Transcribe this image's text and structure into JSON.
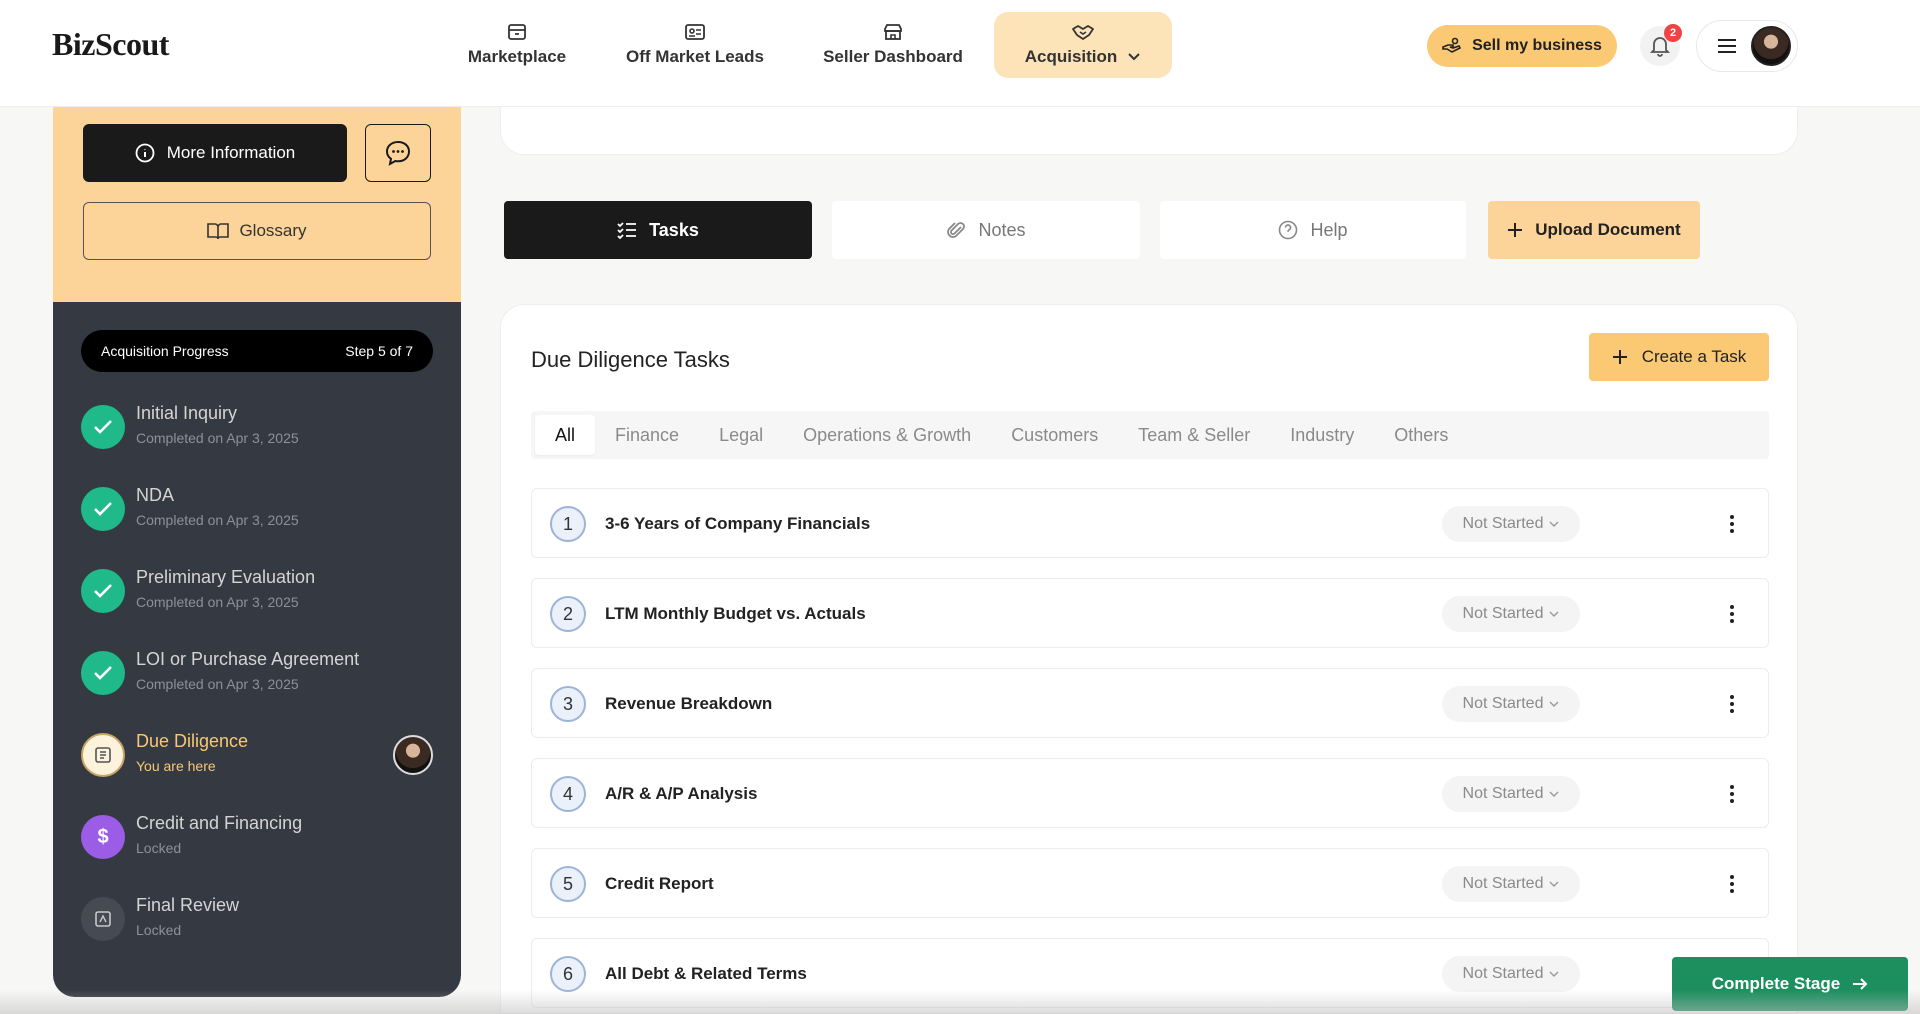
{
  "app": {
    "logo": "BizScout"
  },
  "nav": {
    "marketplace": "Marketplace",
    "off_market": "Off Market Leads",
    "seller_dashboard": "Seller Dashboard",
    "acquisition": "Acquisition"
  },
  "header": {
    "sell_label": "Sell my business",
    "notification_count": "2"
  },
  "sidebar": {
    "more_info": "More Information",
    "glossary": "Glossary",
    "progress_label": "Acquisition Progress",
    "progress_step": "Step 5 of 7",
    "steps": [
      {
        "title": "Initial Inquiry",
        "sub": "Completed on Apr 3, 2025"
      },
      {
        "title": "NDA",
        "sub": "Completed on Apr 3, 2025"
      },
      {
        "title": "Preliminary Evaluation",
        "sub": "Completed on Apr 3, 2025"
      },
      {
        "title": "LOI or Purchase Agreement",
        "sub": "Completed on Apr 3, 2025"
      },
      {
        "title": "Due Diligence",
        "sub": "You are here"
      },
      {
        "title": "Credit and Financing",
        "sub": "Locked",
        "icon_text": "$"
      },
      {
        "title": "Final Review",
        "sub": "Locked"
      }
    ]
  },
  "tabs": {
    "tasks": "Tasks",
    "notes": "Notes",
    "help": "Help",
    "upload": "Upload Document"
  },
  "tasks_card": {
    "title": "Due Diligence Tasks",
    "create": "Create a Task",
    "filters": [
      "All",
      "Finance",
      "Legal",
      "Operations & Growth",
      "Customers",
      "Team & Seller",
      "Industry",
      "Others"
    ],
    "items": [
      {
        "num": "1",
        "name": "3-6 Years of Company Financials",
        "status": "Not Started"
      },
      {
        "num": "2",
        "name": "LTM Monthly Budget vs. Actuals",
        "status": "Not Started"
      },
      {
        "num": "3",
        "name": "Revenue Breakdown",
        "status": "Not Started"
      },
      {
        "num": "4",
        "name": "A/R & A/P Analysis",
        "status": "Not Started"
      },
      {
        "num": "5",
        "name": "Credit Report",
        "status": "Not Started"
      },
      {
        "num": "6",
        "name": "All Debt & Related Terms",
        "status": "Not Started"
      }
    ]
  },
  "footer": {
    "complete_stage": "Complete Stage"
  },
  "colors": {
    "accent": "#fbc874",
    "sidebar_dark": "#353a42",
    "success": "#1fb98a",
    "complete": "#1d8f5f"
  }
}
